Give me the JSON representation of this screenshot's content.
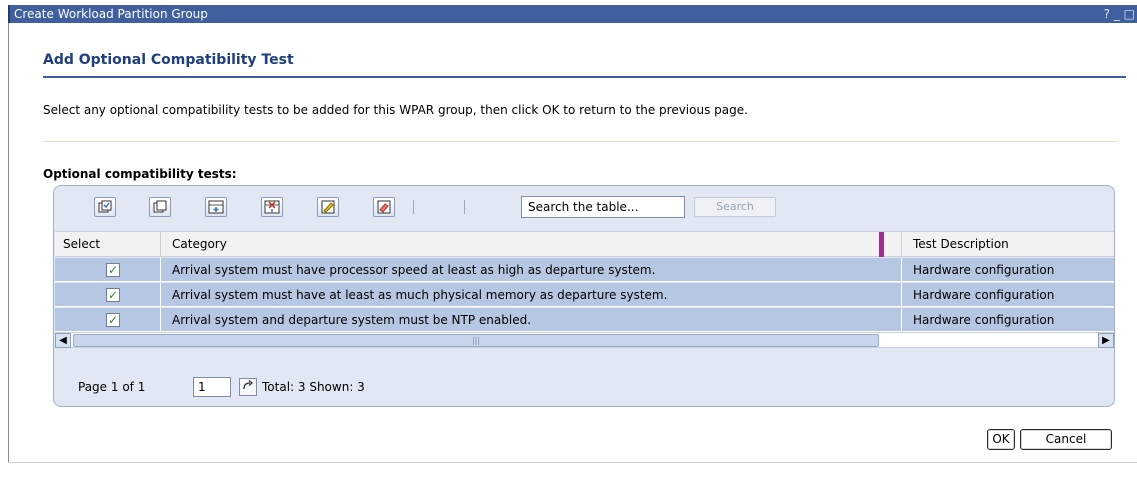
{
  "window": {
    "title": "Create Workload Partition Group",
    "controls": "? _ □"
  },
  "page": {
    "heading": "Add Optional Compatibility Test",
    "intro": "Select any optional compatibility tests to be added for this WPAR group, then click OK to return to the previous page.",
    "section_label": "Optional compatibility tests:"
  },
  "toolbar": {
    "icons": [
      "select-all-icon",
      "deselect-all-icon",
      "show-filter-icon",
      "clear-filter-icon",
      "edit-sort-icon",
      "clear-sort-icon"
    ],
    "search_value": "Search the table...",
    "search_button": "Search"
  },
  "table": {
    "columns": [
      "Select",
      "Category",
      "Test Description"
    ],
    "rows": [
      {
        "checked": "✓",
        "category": "Arrival system must have processor speed at least as high as departure system.",
        "description": "Hardware configuration"
      },
      {
        "checked": "✓",
        "category": "Arrival system must have at least as much physical memory as departure system.",
        "description": "Hardware configuration"
      },
      {
        "checked": "✓",
        "category": "Arrival system and departure system must be NTP enabled.",
        "description": "Hardware configuration"
      }
    ]
  },
  "pager": {
    "page_text": "Page 1 of 1",
    "page_value": "1",
    "totals": "Total: 3 Shown: 3"
  },
  "buttons": {
    "ok": "OK",
    "cancel": "Cancel"
  }
}
